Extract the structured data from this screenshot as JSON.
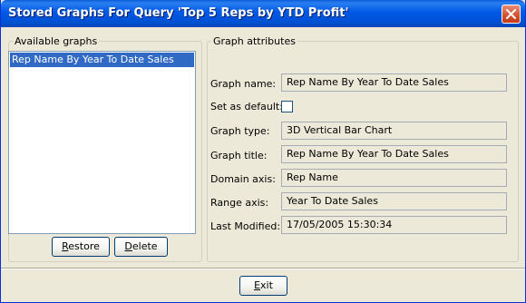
{
  "window": {
    "title": "Stored Graphs For Query 'Top 5 Reps by YTD Profit'",
    "close_icon": "close-icon"
  },
  "available_graphs": {
    "legend": "Available graphs",
    "items": [
      "Rep Name By Year To Date Sales"
    ],
    "selected_index": 0
  },
  "buttons": {
    "restore": "Restore",
    "delete": "Delete",
    "exit": "Exit"
  },
  "attributes": {
    "legend": "Graph attributes",
    "graph_name_label": "Graph name:",
    "graph_name": "Rep Name By Year To Date Sales",
    "set_default_label": "Set as default:",
    "set_default_checked": false,
    "graph_type_label": "Graph type:",
    "graph_type": "3D Vertical Bar Chart",
    "graph_title_label": "Graph title:",
    "graph_title": "Rep Name By Year To Date Sales",
    "domain_axis_label": "Domain axis:",
    "domain_axis": "Rep Name",
    "range_axis_label": "Range axis:",
    "range_axis": "Year To Date Sales",
    "last_modified_label": "Last Modified:",
    "last_modified": "17/05/2005 15:30:34"
  },
  "colors": {
    "titlebar": "#0058e6",
    "selection": "#316ac5",
    "window_bg": "#ece9d8"
  }
}
